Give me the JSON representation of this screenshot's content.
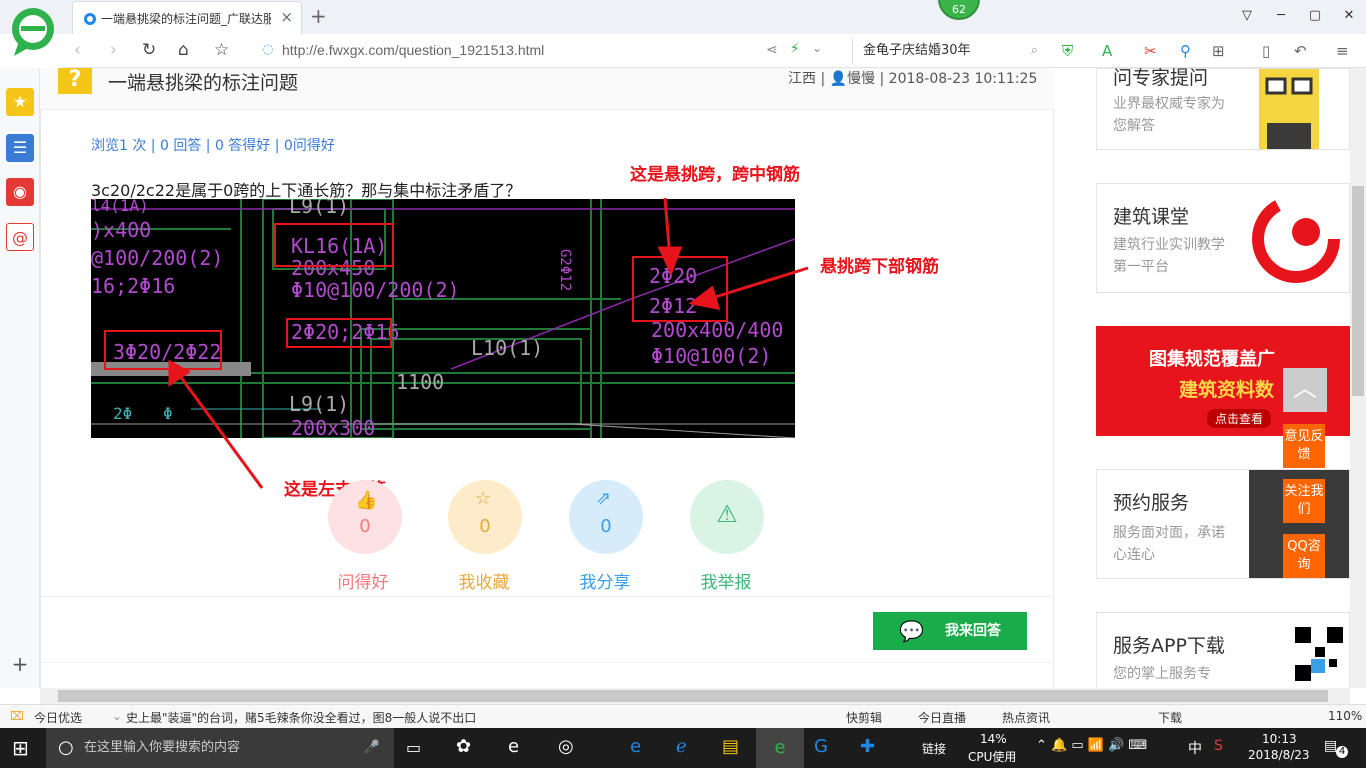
{
  "browser": {
    "tab_title": "一端悬挑梁的标注问题_广联达服",
    "new_tab": "+",
    "badge": "62",
    "url": "http://e.fwxgx.com/question_1921513.html",
    "search_query": "金龟子庆结婚30年",
    "window_controls": [
      "▽",
      "─",
      "▢",
      "✕"
    ]
  },
  "question": {
    "title": "一端悬挑梁的标注问题",
    "meta": "江西 | 👤慢慢 | 2018-08-23 10:11:25",
    "stats": "浏览1 次 | 0 回答 | 0 答得好 | 0问得好",
    "body": "3c20/2c22是属于0跨的上下通长筋？那与集中标注矛盾了？"
  },
  "annotations": {
    "a1": "这是悬挑跨，跨中钢筋",
    "a2": "悬挑跨下部钢筋",
    "a3": "这是左支座筋"
  },
  "cad": {
    "l1": "l4(1A)",
    "l2": ")x400",
    "l3": "@100/200(2)",
    "l4": "16;2Φ16",
    "l5": "L9(1)",
    "l6": "KL16(1A)",
    "l7": "200x450",
    "l8": "Φ10@100/200(2)",
    "l9": "2Φ20;2Φ16",
    "l10": "3Φ20/2Φ22",
    "l11": "L10(1)",
    "l12": "1100",
    "l13": "L9(1)",
    "l14": "200x300",
    "l15": "2Φ20",
    "l16": "2Φ12",
    "l17": "200x400/400",
    "l18": "Φ10@100(2)",
    "l19": "G2Φ12",
    "l20": "2Φ",
    "l21": "Φ"
  },
  "actions": [
    {
      "count": "0",
      "label": "问得好",
      "color": "#f27a7a",
      "bg": "#fde1e3"
    },
    {
      "count": "0",
      "label": "我收藏",
      "color": "#e8a83a",
      "bg": "#fdebc9"
    },
    {
      "count": "0",
      "label": "我分享",
      "color": "#3a9ee8",
      "bg": "#d7ecfb"
    },
    {
      "count": "0",
      "label": "我举报",
      "color": "#3cb878",
      "bg": "#d9f4e4"
    }
  ],
  "answer_button": "我来回答",
  "right_cards": [
    {
      "title": "问专家提问",
      "desc": "业界最权威专家为您解答"
    },
    {
      "title": "建筑课堂",
      "desc": "建筑行业实训教学第一平台"
    },
    {
      "title": "图集规范覆盖广",
      "desc": "建筑资料数",
      "link": "点击查看"
    },
    {
      "title": "预约服务",
      "desc": "服务面对面，承诺心连心"
    },
    {
      "title": "服务APP下载",
      "desc": "您的掌上服务专"
    }
  ],
  "float_buttons": [
    "意见反馈",
    "关注我们",
    "QQ咨询"
  ],
  "statusbar": {
    "left": "今日优选",
    "news": "史上最\"装逼\"的台词，赌5毛辣条你没全看过，图8一般人说不出口",
    "items": [
      "快剪辑",
      "今日直播",
      "热点资讯",
      "下载"
    ],
    "zoom": "110%"
  },
  "taskbar": {
    "search_placeholder": "在这里输入你要搜索的内容",
    "links": "链接",
    "cpu": "14%",
    "cpu_label": "CPU使用",
    "ime": "中",
    "time": "10:13",
    "date": "2018/8/23",
    "notif": "4"
  }
}
